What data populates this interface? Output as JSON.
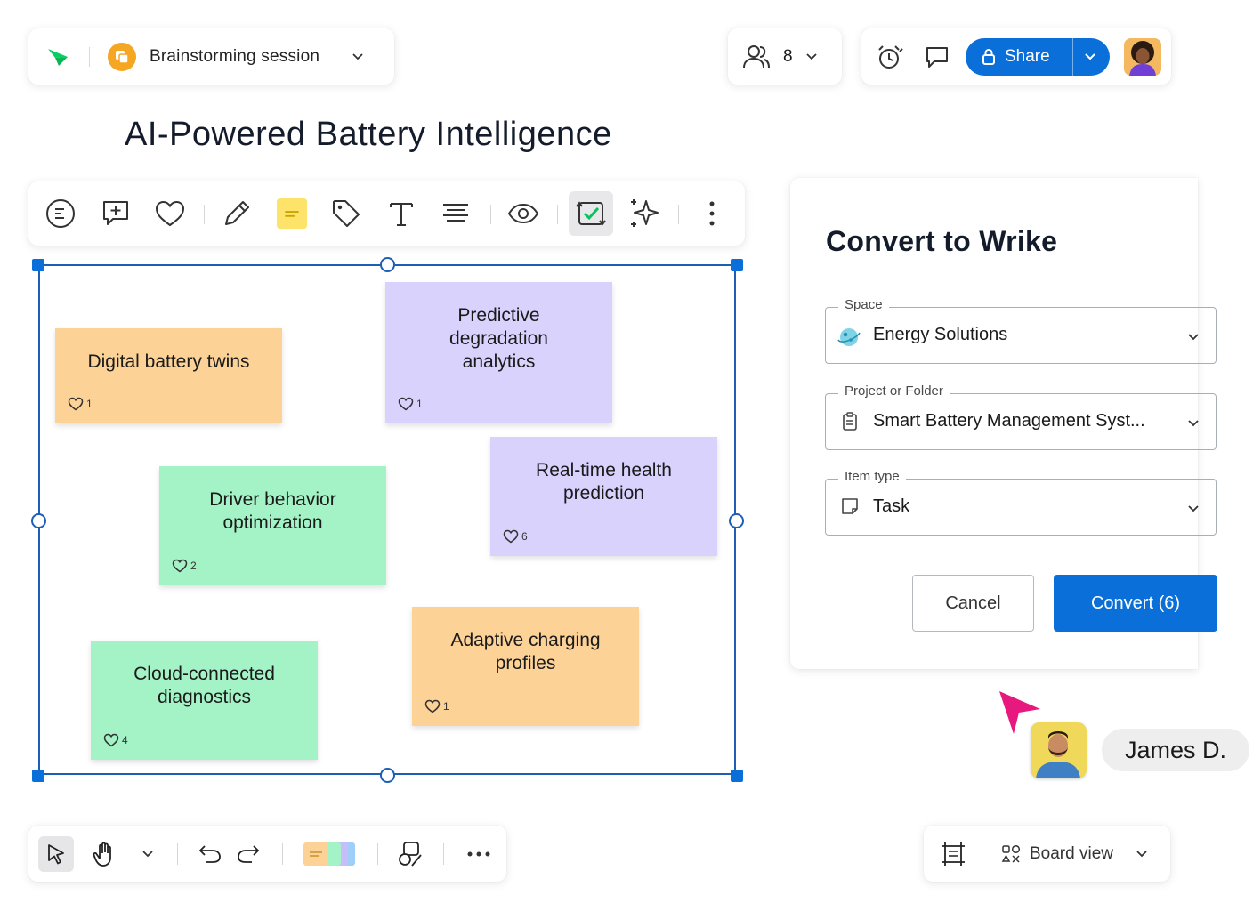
{
  "header": {
    "board_name": "Brainstorming session",
    "participants_count": "8",
    "share_label": "Share"
  },
  "page_title": "AI-Powered Battery Intelligence",
  "toolbar": {
    "items": [
      "text-outline-icon",
      "add-comment-icon",
      "heart-icon",
      "pencil-icon",
      "sticky-note-icon",
      "tag-icon",
      "text-icon",
      "align-icon",
      "eye-icon",
      "convert-icon",
      "ai-sparkle-icon",
      "more-icon"
    ]
  },
  "stickies": [
    {
      "text": "Digital battery twins",
      "likes": "1",
      "color": "#fdd296"
    },
    {
      "text": "Predictive\ndegradation\nanalytics",
      "likes": "1",
      "color": "#d8d2fd"
    },
    {
      "text": "Real-time health\nprediction",
      "likes": "6",
      "color": "#d8d2fd"
    },
    {
      "text": "Driver behavior\noptimization",
      "likes": "2",
      "color": "#a4f3c6"
    },
    {
      "text": "Adaptive charging\nprofiles",
      "likes": "1",
      "color": "#fdd296"
    },
    {
      "text": "Cloud-connected\ndiagnostics",
      "likes": "4",
      "color": "#a4f3c6"
    }
  ],
  "convert_dialog": {
    "title": "Convert to Wrike",
    "space_label": "Space",
    "space_value": "Energy Solutions",
    "project_label": "Project or Folder",
    "project_value": "Smart Battery Management Syst...",
    "item_type_label": "Item type",
    "item_type_value": "Task",
    "cancel_label": "Cancel",
    "convert_label": "Convert (6)"
  },
  "collaborator": {
    "name": "James D.",
    "pointer_color": "#e8197e"
  },
  "bottom_bar": {
    "view_label": "Board view"
  },
  "colors": {
    "accent": "#0a6fd8",
    "selection": "#1d5fb5"
  }
}
